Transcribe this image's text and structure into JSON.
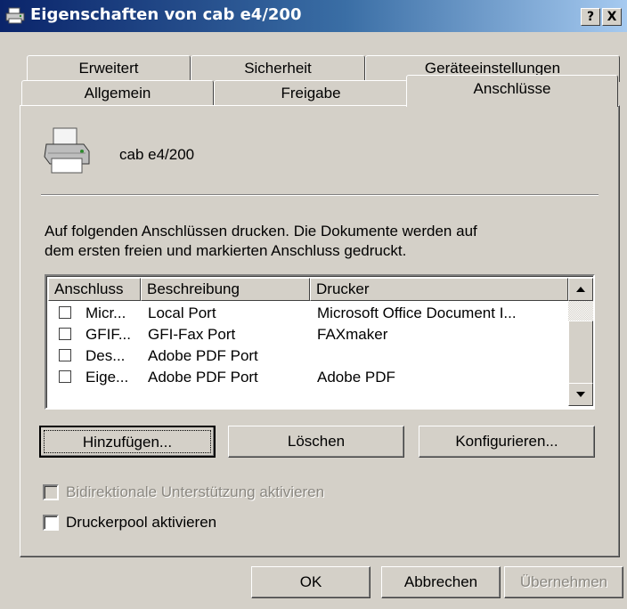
{
  "window": {
    "title": "Eigenschaften von cab e4/200",
    "help_button": "?",
    "close_button": "X"
  },
  "tabs": {
    "back_row": [
      "Erweitert",
      "Sicherheit",
      "Geräteeinstellungen"
    ],
    "front_row": [
      "Allgemein",
      "Freigabe",
      "Anschlüsse"
    ],
    "active": "Anschlüsse"
  },
  "printer": {
    "icon": "printer-icon",
    "name": "cab e4/200"
  },
  "description": {
    "line1": "Auf folgenden Anschlüssen drucken. Die Dokumente werden auf",
    "line2": "dem ersten freien und markierten Anschluss gedruckt."
  },
  "port_list": {
    "headers": [
      "Anschluss",
      "Beschreibung",
      "Drucker"
    ],
    "rows": [
      {
        "port": "Micr...",
        "description": "Local Port",
        "printer": "Microsoft Office Document I...",
        "checked": false
      },
      {
        "port": "GFIF...",
        "description": "GFI-Fax Port",
        "printer": "FAXmaker",
        "checked": false
      },
      {
        "port": "Des...",
        "description": "Adobe PDF Port",
        "printer": "",
        "checked": false
      },
      {
        "port": "Eige...",
        "description": "Adobe PDF Port",
        "printer": "Adobe PDF",
        "checked": false
      }
    ]
  },
  "port_buttons": {
    "add": "Hinzufügen...",
    "delete": "Löschen",
    "configure": "Konfigurieren..."
  },
  "options": {
    "bidirectional": {
      "label": "Bidirektionale Unterstützung aktivieren",
      "checked": false,
      "enabled": false
    },
    "pool": {
      "label": "Druckerpool aktivieren",
      "checked": false,
      "enabled": true
    }
  },
  "footer": {
    "ok": "OK",
    "cancel": "Abbrechen",
    "apply": "Übernehmen"
  }
}
